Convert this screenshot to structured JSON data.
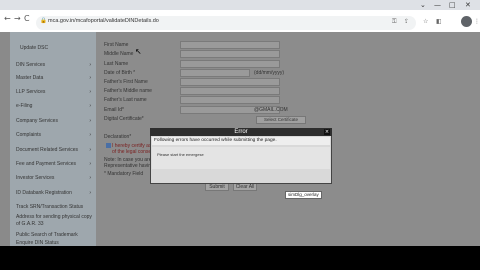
{
  "browser": {
    "window_controls": {
      "minimize": "—",
      "maximize": "□",
      "close": "✕",
      "menu": "⌄"
    },
    "nav": {
      "back": "←",
      "forward": "→",
      "reload": "C"
    },
    "address": "mca.gov.in/mcafoportal/validateDINDetails.do",
    "lock": "🔒",
    "toolbar_icons": [
      "key-icon",
      "share-icon",
      "star-icon",
      "extension-icon",
      "menu-icon"
    ],
    "toolbar_glyphs": {
      "key": "⚿",
      "share": "⇪",
      "star": "☆",
      "ext": "◧",
      "menu": "⋮"
    }
  },
  "sidebar": {
    "top_items": [
      "",
      "Update DSC"
    ],
    "items": [
      {
        "label": "DIN Services"
      },
      {
        "label": "Master Data"
      },
      {
        "label": "LLP Services"
      },
      {
        "label": "e-Filing"
      },
      {
        "label": "Company Services"
      },
      {
        "label": "Complaints"
      },
      {
        "label": "Document Related Services"
      },
      {
        "label": "Fee and Payment Services"
      },
      {
        "label": "Investor Services"
      },
      {
        "label": "ID Databank Registration"
      }
    ],
    "plain_items": [
      "Track SRN/Transaction Status",
      "Address for sending physical copy of G.A.R. 33",
      "Public Search of Trademark",
      "Enquire DIN Status"
    ]
  },
  "form": {
    "fields": [
      {
        "label": "First Name"
      },
      {
        "label": "Middle Name"
      },
      {
        "label": "Last Name"
      },
      {
        "label": "Date of Birth *"
      },
      {
        "label": "Father's First Name"
      },
      {
        "label": "Father's Middle name"
      },
      {
        "label": "Father's Last name"
      },
      {
        "label": "Email Id*"
      },
      {
        "label": "Digital Certificate*"
      }
    ],
    "dob_hint": "(dd/mm/yyyy)",
    "email_hint": "@GMAIL.COM",
    "select_cert_button": "Select Certificate",
    "declaration_label": "Declaration*",
    "declaration_text_1": "I hereby certify as",
    "declaration_text_2": "of the legal conseque",
    "note_1": "Note: In case you are a",
    "note_2": "Representative having",
    "mandatory": "* Mandatory Field",
    "submit": "Submit",
    "clear": "Clear All"
  },
  "modal": {
    "title": "Error",
    "close": "×",
    "message": "Following errors have occurred while submitting the page.",
    "detail": "Please start the emergese"
  },
  "tooltip": "simDlg_overlay"
}
